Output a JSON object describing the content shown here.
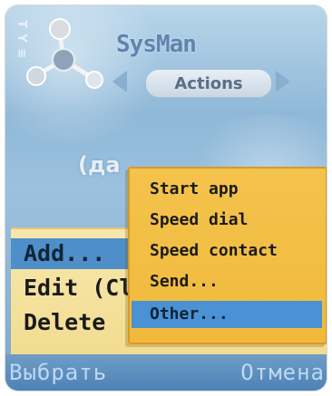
{
  "header": {
    "app_title": "SysMan",
    "tab_label": "Actions",
    "signal_text": "T Y ≡",
    "icons": {
      "logo": "molecule-logo-icon",
      "signal": "signal-strength-icon",
      "tab_prev": "arrow-left-icon",
      "tab_next": "arrow-right-icon"
    }
  },
  "background": {
    "partial_text": "(да"
  },
  "list": {
    "items": [
      {
        "label": "Add...",
        "selected": true
      },
      {
        "label": "Edit (Cl",
        "selected": false
      },
      {
        "label": "Delete",
        "selected": false
      }
    ]
  },
  "popup": {
    "items": [
      {
        "label": "Start app",
        "selected": false
      },
      {
        "label": "Speed dial",
        "selected": false
      },
      {
        "label": "Speed contact",
        "selected": false
      },
      {
        "label": "Send...",
        "selected": false
      },
      {
        "label": "Other...",
        "selected": true
      }
    ]
  },
  "softkeys": {
    "left": "Выбрать",
    "right": "Отмена"
  },
  "colors": {
    "accent": "#4b92d4",
    "popup_bg": "#f2bd42",
    "list_bg": "#f5e2a0",
    "softkey_text": "#bcd9f2"
  }
}
